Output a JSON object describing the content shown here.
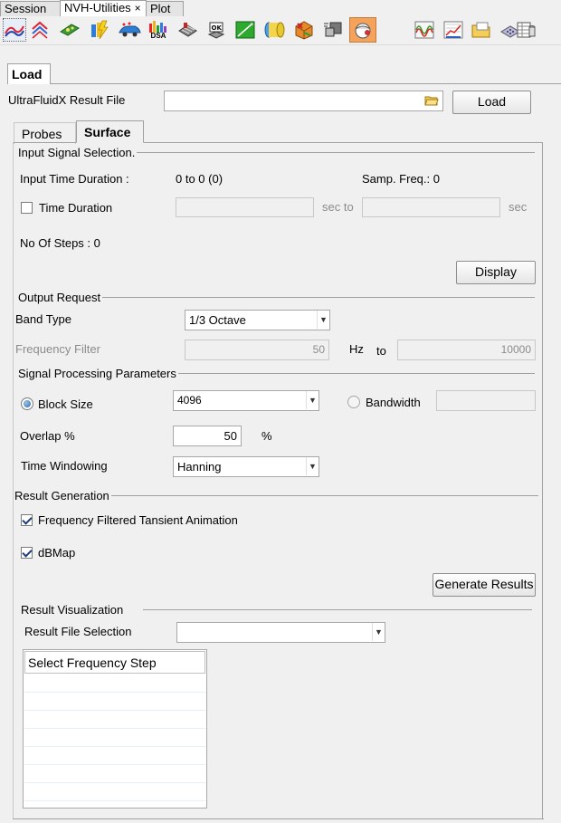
{
  "top_tabs": {
    "session": "Session",
    "nvh": "NVH-Utilities",
    "nvh_close": "×",
    "plot": "Plot"
  },
  "toolbar_icons": [
    "curves-icon",
    "overlay-curves-icon",
    "model-icon",
    "energy-icon",
    "car-probe-icon",
    "dsa-icon",
    "grid-icon",
    "ok-block-icon",
    "grid-green-icon",
    "cylinder-icon",
    "cube-icon",
    "card-icon",
    "orange-ball-icon",
    "waveform-icon",
    "chart-red-icon",
    "folder-icon",
    "plate-icon",
    "table-icon"
  ],
  "toolbar_texts": {
    "dsa": "DSA",
    "ok": "OK"
  },
  "load_tab": "Load",
  "result_file": {
    "label": "UltraFluidX Result File",
    "value": "",
    "load_button": "Load"
  },
  "sub_tabs": {
    "probes": "Probes",
    "surface": "Surface"
  },
  "input_signal": {
    "title": "Input Signal Selection.",
    "duration_label": "Input Time Duration :",
    "duration_value": "0 to 0 (0)",
    "samp_freq": "Samp. Freq.: 0",
    "time_duration_label": "Time Duration",
    "time_duration_checked": false,
    "from_value": "",
    "sec_to": "sec to",
    "to_value": "",
    "sec": "sec",
    "steps": "No Of Steps : 0",
    "display_button": "Display"
  },
  "output_request": {
    "title": "Output Request",
    "band_type_label": "Band Type",
    "band_type_value": "1/3 Octave",
    "freq_filter_label": "Frequency Filter",
    "freq_from": "50",
    "hz": "Hz",
    "to": "to",
    "freq_to": "10000"
  },
  "signal_processing": {
    "title": "Signal Processing Parameters",
    "block_size_label": "Block Size",
    "block_size_selected": true,
    "block_size_value": "4096",
    "bandwidth_label": "Bandwidth",
    "bandwidth_value": "",
    "overlap_label": "Overlap %",
    "overlap_value": "50",
    "percent": "%",
    "time_windowing_label": "Time Windowing",
    "time_windowing_value": "Hanning"
  },
  "result_generation": {
    "title": "Result Generation",
    "freq_filtered_label": "Frequency Filtered Tansient Animation",
    "freq_filtered_checked": true,
    "dbmap_label": "dBMap",
    "dbmap_checked": true,
    "generate_button": "Generate Results"
  },
  "result_visualization": {
    "title": "Result Visualization",
    "file_selection_label": "Result File Selection",
    "file_selection_value": "",
    "table_header": "Select Frequency Step",
    "rows": [
      "",
      "",
      "",
      "",
      "",
      "",
      "",
      "",
      ""
    ]
  },
  "colors": {
    "panel": "#f0f0f0",
    "accent": "#2b66ad",
    "orange_button": "#f5a35a"
  }
}
